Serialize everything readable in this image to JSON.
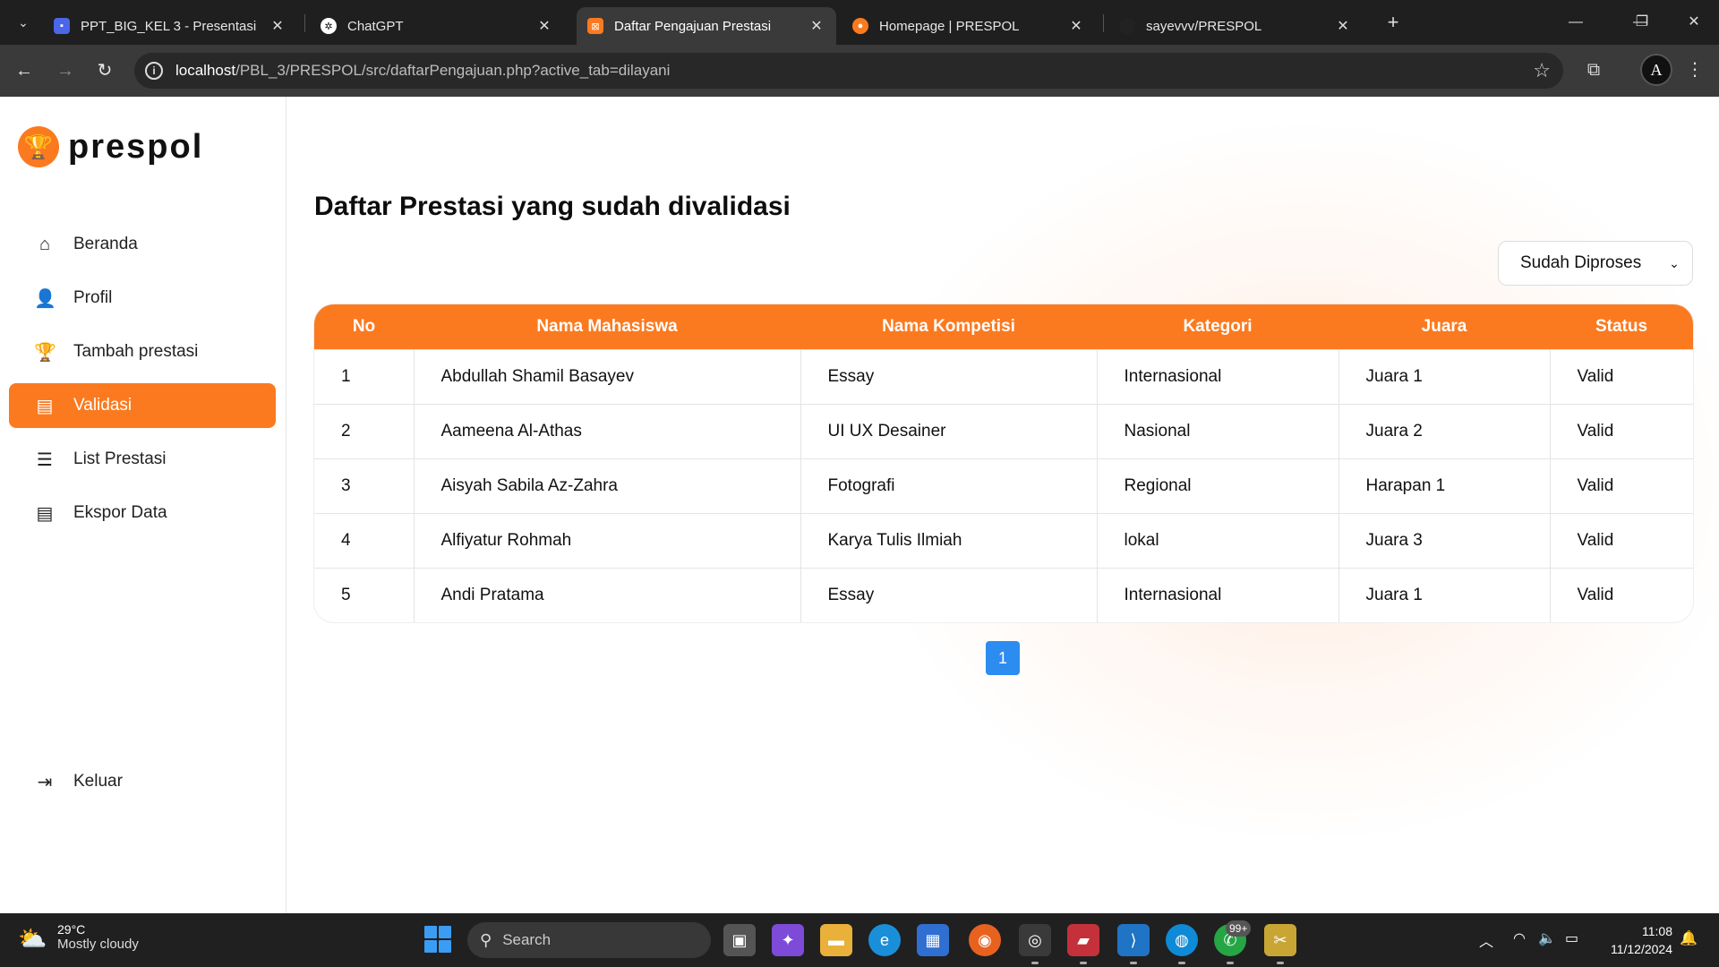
{
  "browser": {
    "tabs": [
      {
        "title": "PPT_BIG_KEL 3 - Presentasi",
        "icon": "slides-icon",
        "color": "#4a67e8",
        "active": false
      },
      {
        "title": "ChatGPT",
        "icon": "chatgpt-icon",
        "color": "#ffffff",
        "active": false
      },
      {
        "title": "Daftar Pengajuan Prestasi",
        "icon": "xampp-icon",
        "color": "#fb7a1f",
        "active": true
      },
      {
        "title": "Homepage | PRESPOL",
        "icon": "prespol-icon",
        "color": "#fb7a1f",
        "active": false
      },
      {
        "title": "sayevvv/PRESPOL",
        "icon": "github-icon",
        "color": "#222222",
        "active": false
      }
    ],
    "url_host": "localhost",
    "url_path": "/PBL_3/PRESPOL/src/daftarPengajuan.php?active_tab=dilayani",
    "profile_initial": "A"
  },
  "sidebar": {
    "logo_text": "prespol",
    "items": [
      {
        "label": "Beranda",
        "icon": "home-icon",
        "active": false
      },
      {
        "label": "Profil",
        "icon": "user-icon",
        "active": false
      },
      {
        "label": "Tambah prestasi",
        "icon": "trophy-icon",
        "active": false
      },
      {
        "label": "Validasi",
        "icon": "file-icon",
        "active": true
      },
      {
        "label": "List Prestasi",
        "icon": "list-icon",
        "active": false
      },
      {
        "label": "Ekspor Data",
        "icon": "file-export-icon",
        "active": false
      }
    ],
    "logout_label": "Keluar"
  },
  "main": {
    "title": "Daftar Prestasi yang sudah divalidasi",
    "filter_value": "Sudah Diproses",
    "table": {
      "columns": [
        "No",
        "Nama Mahasiswa",
        "Nama Kompetisi",
        "Kategori",
        "Juara",
        "Status"
      ],
      "rows": [
        [
          "1",
          "Abdullah Shamil Basayev",
          "Essay",
          "Internasional",
          "Juara 1",
          "Valid"
        ],
        [
          "2",
          "Aameena Al-Athas",
          "UI UX Desainer",
          "Nasional",
          "Juara 2",
          "Valid"
        ],
        [
          "3",
          "Aisyah Sabila Az-Zahra",
          "Fotografi",
          "Regional",
          "Harapan 1",
          "Valid"
        ],
        [
          "4",
          "Alfiyatur Rohmah",
          "Karya Tulis Ilmiah",
          "lokal",
          "Juara 3",
          "Valid"
        ],
        [
          "5",
          "Andi Pratama",
          "Essay",
          "Internasional",
          "Juara 1",
          "Valid"
        ]
      ]
    },
    "page_number": "1"
  },
  "taskbar": {
    "temperature": "29°C",
    "weather": "Mostly cloudy",
    "search_label": "Search",
    "notification_badge": "99+",
    "time": "11:08",
    "date": "11/12/2024"
  },
  "colors": {
    "accent": "#fb7a1f",
    "pagination": "#2d8cf0"
  }
}
